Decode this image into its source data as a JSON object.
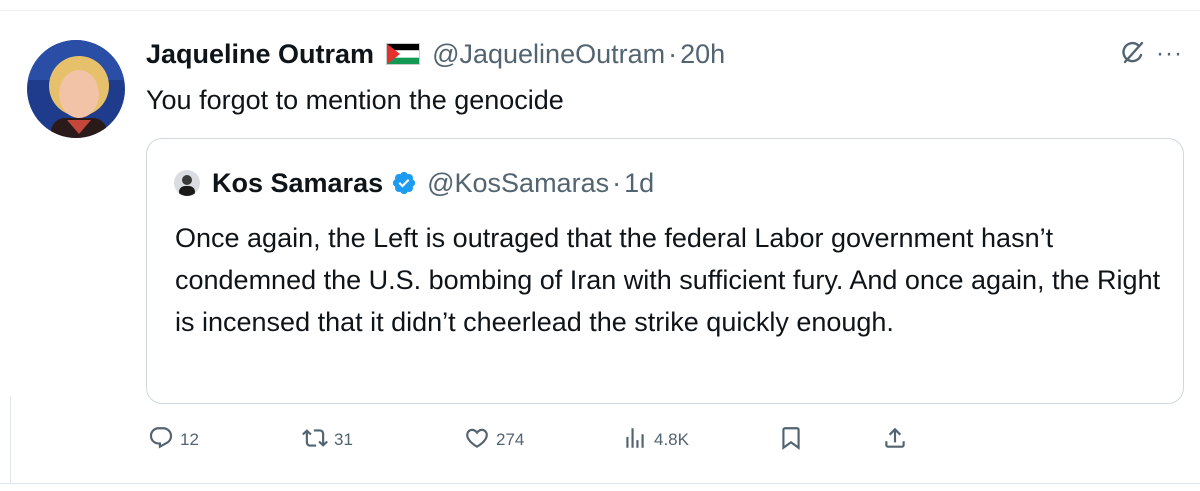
{
  "tweet": {
    "author_name": "Jaqueline Outram",
    "handle": "@JaquelineOutram",
    "separator": "·",
    "time": "20h",
    "text": "You forgot to mention the genocide",
    "more": "···"
  },
  "quote": {
    "author_name": "Kos Samaras",
    "handle": "@KosSamaras",
    "separator": "·",
    "time": "1d",
    "text": "Once again, the Left is outraged that the federal Labor government hasn’t condemned the U.S. bombing of Iran with sufficient fury. And once again, the Right is incensed that it didn’t cheerlead the strike quickly enough."
  },
  "actions": {
    "replies": "12",
    "reposts": "31",
    "likes": "274",
    "views": "4.8K"
  },
  "colors": {
    "text": "#0f1419",
    "secondary": "#536471",
    "verified": "#1d9bf0",
    "border": "#cfd9de"
  },
  "icons": [
    "grok-icon",
    "more-icon",
    "reply-icon",
    "repost-icon",
    "like-icon",
    "views-icon",
    "bookmark-icon",
    "share-icon",
    "verified-badge-icon",
    "palestine-flag-icon"
  ]
}
